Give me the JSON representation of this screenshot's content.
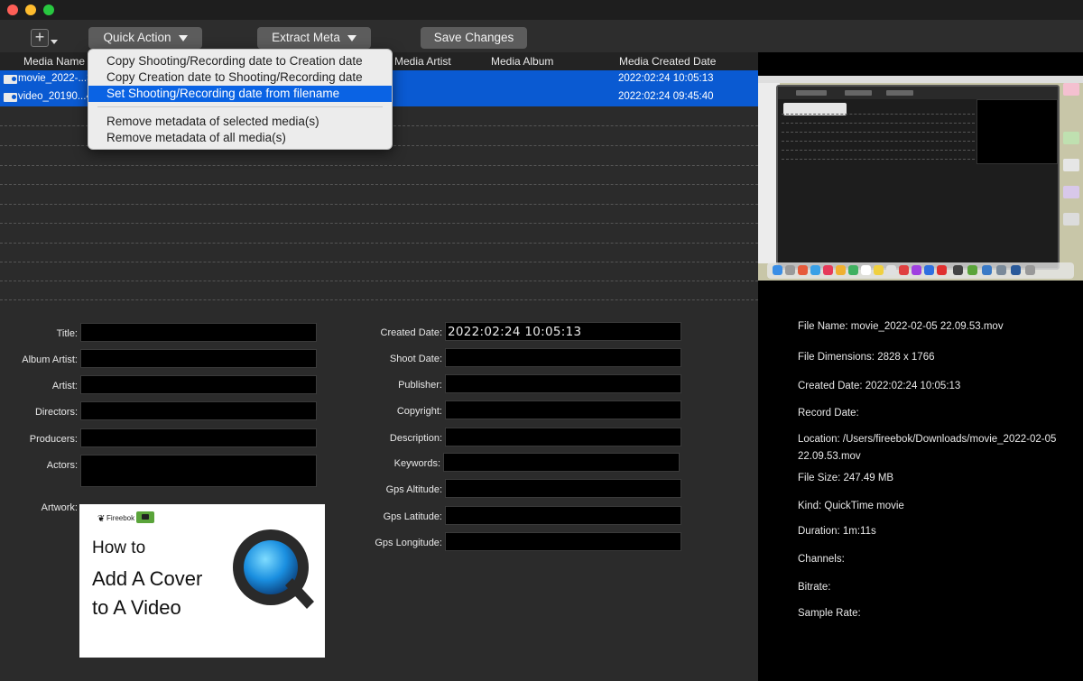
{
  "toolbar": {
    "add_label": "+",
    "quick_action_label": "Quick Action",
    "extract_meta_label": "Extract Meta",
    "save_changes_label": "Save Changes"
  },
  "table": {
    "columns": [
      "Media Name",
      "Media Artist",
      "Media Album",
      "Media Created Date"
    ],
    "rows": [
      {
        "name": "movie_2022-...3",
        "created": "2022:02:24 10:05:13",
        "selected": true
      },
      {
        "name": "video_20190...4",
        "created": "2022:02:24 09:45:40",
        "selected": true
      }
    ]
  },
  "quick_action_menu": {
    "items": [
      "Copy Shooting/Recording date to Creation date",
      "Copy Creation date to Shooting/Recording date",
      "Set Shooting/Recording date from filename",
      "Remove metadata of selected media(s)",
      "Remove metadata of all media(s)"
    ],
    "highlighted_index": 2
  },
  "form": {
    "left_labels": [
      "Title:",
      "Album Artist:",
      "Artist:",
      "Directors:",
      "Producers:",
      "Actors:",
      "Artwork:"
    ],
    "right_labels": [
      "Created Date:",
      "Shoot Date:",
      "Publisher:",
      "Copyright:",
      "Description:",
      "Keywords:",
      "Gps Altitude:",
      "Gps Latitude:",
      "Gps Longitude:"
    ],
    "created_date_value": "2022:02:24 10:05:13"
  },
  "artwork": {
    "brand": "Fireebok",
    "line1": "How to",
    "line2": "Add A Cover",
    "line3": "to A Video"
  },
  "info": {
    "file_name": "File Name: movie_2022-02-05 22.09.53.mov",
    "dimensions": "File Dimensions: 2828 x 1766",
    "created": "Created Date: 2022:02:24 10:05:13",
    "record": "Record Date:",
    "location_1": "Location: /Users/fireebok/Downloads/movie_2022-02-05",
    "location_2": "22.09.53.mov",
    "size": "File Size: 247.49 MB",
    "kind": "Kind: QuickTime movie",
    "duration": "Duration: 1m:11s",
    "channels": "Channels:",
    "bitrate": "Bitrate:",
    "sample_rate": "Sample Rate:"
  },
  "colors": {
    "selection": "#0a5ad2",
    "menu_highlight": "#0a63e4",
    "window_bg": "#2b2b2b",
    "field_bg": "#000000"
  }
}
